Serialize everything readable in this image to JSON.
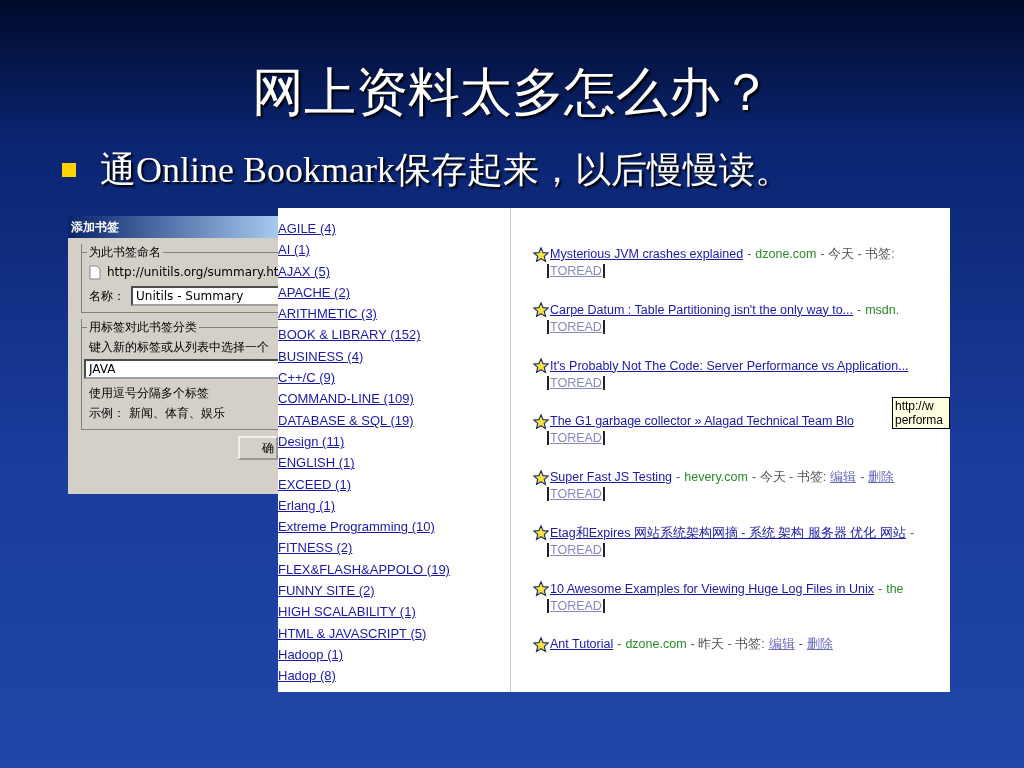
{
  "slide": {
    "title": "网上资料太多怎么办？",
    "bullets": [
      "通Online Bookmark保存起来，以后慢慢读。"
    ]
  },
  "dialog": {
    "title": "添加书签",
    "name_group": {
      "legend": "为此书签命名",
      "url": "http://unitils.org/summary.ht",
      "name_label": "名称：",
      "name_value": "Unitils - Summary"
    },
    "tag_group": {
      "legend": "用标签对此书签分类",
      "prompt": "键入新的标签或从列表中选择一个",
      "tags_value": "JAVA",
      "hint": "使用逗号分隔多个标签",
      "example": "示例： 新闻、体育、娱乐"
    },
    "buttons": [
      "确"
    ]
  },
  "tags": [
    "AGILE (4)",
    "AI (1)",
    "AJAX (5)",
    "APACHE (2)",
    "ARITHMETIC (3)",
    "BOOK & LIBRARY (152)",
    "BUSINESS (4)",
    "C++/C (9)",
    "COMMAND-LINE (109)",
    "DATABASE & SQL (19)",
    "Design (11)",
    "ENGLISH (1)",
    "EXCEED (1)",
    "Erlang (1)",
    "Extreme Programming (10)",
    "FITNESS (2)",
    "FLEX&FLASH&APPOLO (19)",
    "FUNNY SITE (2)",
    "HIGH SCALABILITY (1)",
    "HTML & JAVASCRIPT (5)",
    "Hadoop (1)",
    "Hadop (8)"
  ],
  "bookmarks": [
    {
      "title": "Mysterious JVM crashes explained",
      "meta": [
        {
          "text": "-",
          "kind": "plain"
        },
        {
          "text": "dzone.com",
          "kind": "source"
        },
        {
          "text": "- 今天 - 书签:",
          "kind": "plain"
        }
      ],
      "tag": "TOREAD"
    },
    {
      "title": "Carpe Datum : Table Partitioning isn't the only way to...",
      "meta": [
        {
          "text": "-",
          "kind": "plain"
        },
        {
          "text": "msdn.",
          "kind": "source"
        }
      ],
      "tag": "TOREAD"
    },
    {
      "title": "It's Probably Not The Code: Server Performance vs Application...",
      "tag": "TOREAD"
    },
    {
      "title": "The G1 garbage collector » Alagad Technical Team Blo",
      "tag": "TOREAD",
      "tooltip": [
        "http://w",
        "performa"
      ]
    },
    {
      "title": "Super Fast JS Testing",
      "meta": [
        {
          "text": "-",
          "kind": "plain"
        },
        {
          "text": "hevery.com",
          "kind": "source"
        },
        {
          "text": "- 今天 - 书签:",
          "kind": "plain"
        },
        {
          "text": "编辑",
          "kind": "action"
        },
        {
          "text": "-",
          "kind": "plain"
        },
        {
          "text": "删除",
          "kind": "action"
        }
      ],
      "tag": "TOREAD"
    },
    {
      "title": "Etag和Expires 网站系统架构网摘 - 系统 架构 服务器 优化 网站",
      "meta": [
        {
          "text": "-",
          "kind": "plain"
        }
      ],
      "tag": "TOREAD"
    },
    {
      "title": "10 Awesome Examples for Viewing Huge Log Files in Unix",
      "meta": [
        {
          "text": "-",
          "kind": "plain"
        },
        {
          "text": "the",
          "kind": "source"
        }
      ],
      "tag": "TOREAD"
    },
    {
      "title": "Ant Tutorial",
      "meta": [
        {
          "text": "-",
          "kind": "plain"
        },
        {
          "text": "dzone.com",
          "kind": "source"
        },
        {
          "text": "- 昨天 - 书签:",
          "kind": "plain"
        },
        {
          "text": "编辑",
          "kind": "action"
        },
        {
          "text": "-",
          "kind": "plain"
        },
        {
          "text": "删除",
          "kind": "action"
        }
      ]
    }
  ]
}
